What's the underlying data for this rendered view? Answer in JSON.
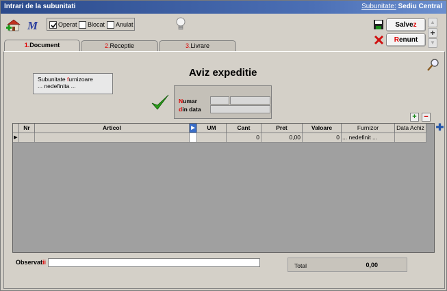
{
  "window": {
    "title": "Intrari de la subunitati",
    "subunit_label": "Subunitate:",
    "subunit_value": "Sediu Central"
  },
  "toolbar": {
    "operat_label": "Operat",
    "operat_checked": true,
    "blocat_label": "Blocat",
    "blocat_checked": false,
    "anulat_label": "Anulat",
    "anulat_checked": false,
    "icons": [
      "add-house-icon",
      "script-m-icon",
      "lightbulb-icon",
      "search-icon"
    ]
  },
  "buttons": {
    "save_prefix": "Salve",
    "save_hotkey": "z",
    "cancel_hotkey": "R",
    "cancel_rest": "enunt"
  },
  "tabs": [
    {
      "num": "1.",
      "label": "Document"
    },
    {
      "num": "2.",
      "label": "Receptie"
    },
    {
      "num": "3.",
      "label": "Livrare"
    }
  ],
  "document": {
    "heading": "Aviz expeditie",
    "subunit_line1_pre": "Subunitate ",
    "subunit_line1_hot": "f",
    "subunit_line1_post": "urnizoare",
    "subunit_line2": "... nedefinita ...",
    "numar_hot": "N",
    "numar_rest": "umar",
    "data_hot": "d",
    "data_rest": "in data"
  },
  "grid": {
    "columns": [
      "Nr",
      "Articol",
      "UM",
      "Cant",
      "Pret",
      "Valoare",
      "Furnizor",
      "Data Achiz"
    ],
    "rows": [
      {
        "nr": "",
        "articol": "",
        "um": "",
        "cant": "0",
        "pret": "0,00",
        "valoare": "0",
        "furnizor": "... nedefinit ...",
        "data_achiz": ""
      }
    ]
  },
  "footer": {
    "obs_pre": "Observat",
    "obs_hot": "ii",
    "obs_value": "",
    "total_label": "Total",
    "total_value": "0,00"
  },
  "colors": {
    "hotkey": "#d00000",
    "title_bar": "#2b4a8b",
    "check_green": "#2a9a1a"
  }
}
